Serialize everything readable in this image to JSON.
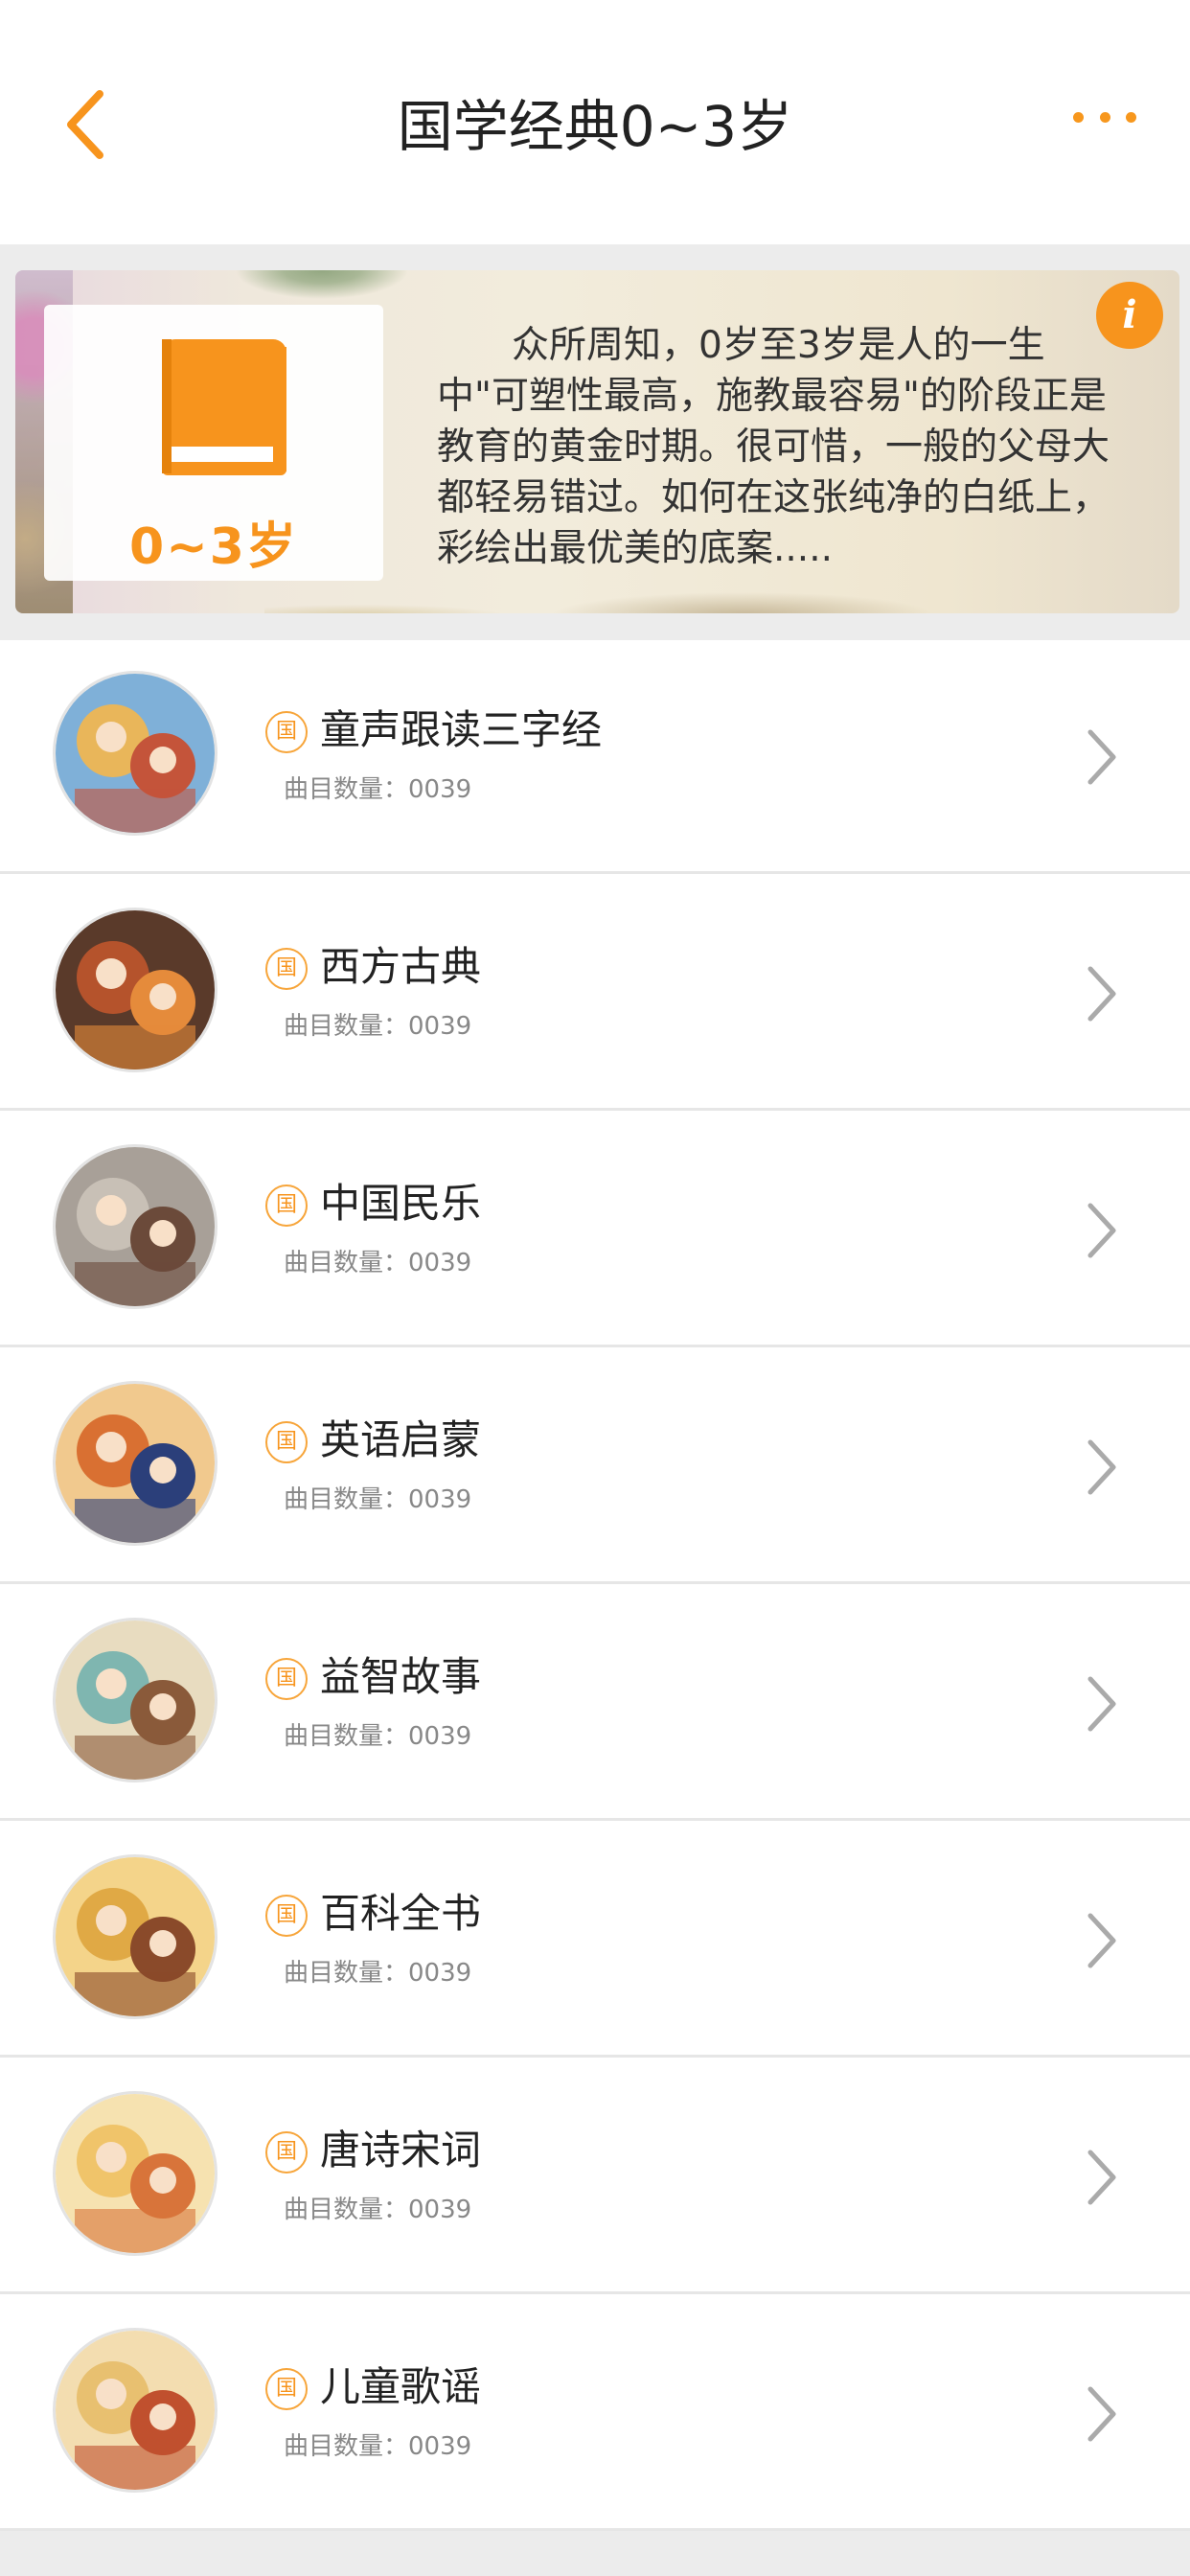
{
  "nav": {
    "title": "国学经典0~3岁",
    "back_icon": "chevron-left-icon",
    "more_icon": "more-dots-icon",
    "accent": "#f7941d"
  },
  "banner": {
    "cover_label": "0~3岁",
    "book_icon": "book-icon",
    "info_icon": "info-icon",
    "info_glyph": "i",
    "description": "众所周知，0岁至3岁是人的一生中\"可塑性最高，施教最容易\"的阶段正是教育的黄金时期。很可惜，一般的父母大都轻易错过。如何在这张纯净的白纸上，彩绘出最优美的底案....."
  },
  "list": {
    "badge_text": "国",
    "chevron_icon": "chevron-right-icon",
    "items": [
      {
        "title": "童声跟读三字经",
        "count_label": "曲目数量：0039",
        "thumb_colors": [
          "#e9b65a",
          "#c4543a",
          "#7fb0d8"
        ]
      },
      {
        "title": "西方古典",
        "count_label": "曲目数量：0039",
        "thumb_colors": [
          "#b5532c",
          "#e58b3b",
          "#5a3a2a"
        ]
      },
      {
        "title": "中国民乐",
        "count_label": "曲目数量：0039",
        "thumb_colors": [
          "#c8c0b6",
          "#6b4a3a",
          "#a8a098"
        ]
      },
      {
        "title": "英语启蒙",
        "count_label": "曲目数量：0039",
        "thumb_colors": [
          "#d97032",
          "#2b3f7a",
          "#f1c98e"
        ]
      },
      {
        "title": "益智故事",
        "count_label": "曲目数量：0039",
        "thumb_colors": [
          "#7fb6b0",
          "#8a5a3a",
          "#e8dcc0"
        ]
      },
      {
        "title": "百科全书",
        "count_label": "曲目数量：0039",
        "thumb_colors": [
          "#e0a945",
          "#8a4a2a",
          "#f4d48a"
        ]
      },
      {
        "title": "唐诗宋词",
        "count_label": "曲目数量：0039",
        "thumb_colors": [
          "#f0c46a",
          "#d8743a",
          "#f6e2b0"
        ]
      },
      {
        "title": "儿童歌谣",
        "count_label": "曲目数量：0039",
        "thumb_colors": [
          "#e8c070",
          "#c0502e",
          "#f3ddb0"
        ]
      }
    ]
  }
}
